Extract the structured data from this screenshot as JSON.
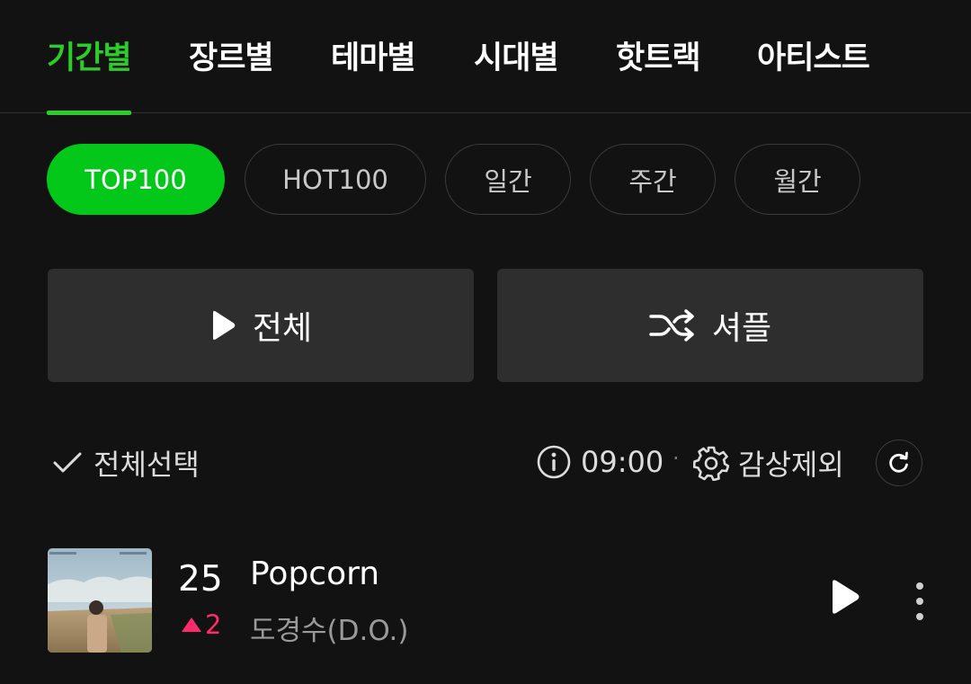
{
  "top_tabs": [
    {
      "label": "기간별",
      "active": true
    },
    {
      "label": "장르별",
      "active": false
    },
    {
      "label": "테마별",
      "active": false
    },
    {
      "label": "시대별",
      "active": false
    },
    {
      "label": "핫트랙",
      "active": false
    },
    {
      "label": "아티스트",
      "active": false
    }
  ],
  "period_chips": [
    {
      "label": "TOP100",
      "active": true
    },
    {
      "label": "HOT100",
      "active": false
    },
    {
      "label": "일간",
      "active": false
    },
    {
      "label": "주간",
      "active": false
    },
    {
      "label": "월간",
      "active": false
    }
  ],
  "actions": {
    "play_all_label": "전체",
    "play_icon": "play-icon",
    "shuffle_label": "셔플",
    "shuffle_icon": "shuffle-icon"
  },
  "toolbar": {
    "select_all_label": "전체선택",
    "select_all_icon": "check-icon",
    "update_time": "09:00",
    "info_icon": "info-icon",
    "separator": "·",
    "exclude_label": "감상제외",
    "exclude_icon": "gear-icon",
    "refresh_icon": "refresh-icon"
  },
  "songs": [
    {
      "rank": "25",
      "rank_change": "2",
      "rank_direction": "up",
      "title": "Popcorn",
      "artist": "도경수(D.O.)",
      "album_art": "album-cover-image",
      "play_icon": "play-icon",
      "more_icon": "more-vertical-icon"
    }
  ],
  "colors": {
    "background": "#121212",
    "accent_green": "#2ccc2c",
    "chip_active": "#03c81a",
    "rank_up": "#ff2a6b",
    "button_bg": "#2e2e2e"
  }
}
